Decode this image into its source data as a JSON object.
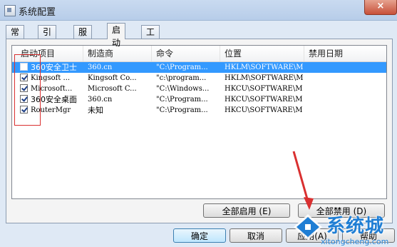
{
  "window": {
    "title": "系统配置",
    "close_glyph": "×"
  },
  "tabs": [
    {
      "label": "常规"
    },
    {
      "label": "引导"
    },
    {
      "label": "服务"
    },
    {
      "label": "启动",
      "active": true
    },
    {
      "label": "工具"
    }
  ],
  "list": {
    "columns": [
      "启动项目",
      "制造商",
      "命令",
      "位置",
      "禁用日期"
    ],
    "rows": [
      {
        "checked": false,
        "selected": true,
        "item": "360安全卫士",
        "maker": "360.cn",
        "command": "\"C:\\Program...",
        "location": "HKLM\\SOFTWARE\\M...",
        "disabled_date": ""
      },
      {
        "checked": true,
        "selected": false,
        "item": "Kingsoft ...",
        "maker": "Kingsoft Co...",
        "command": "\"c:\\program...",
        "location": "HKLM\\SOFTWARE\\M...",
        "disabled_date": ""
      },
      {
        "checked": true,
        "selected": false,
        "item": "Microsoft...",
        "maker": "Microsoft C...",
        "command": "\"C:\\Windows...",
        "location": "HKCU\\SOFTWARE\\M...",
        "disabled_date": ""
      },
      {
        "checked": true,
        "selected": false,
        "item": "360安全桌面",
        "maker": "360.cn",
        "command": "\"C:\\Program...",
        "location": "HKCU\\SOFTWARE\\M...",
        "disabled_date": ""
      },
      {
        "checked": true,
        "selected": false,
        "item": "RouterMgr",
        "maker": "未知",
        "command": "\"C:\\Program...",
        "location": "HKCU\\SOFTWARE\\M...",
        "disabled_date": ""
      }
    ]
  },
  "buttons": {
    "enable_all": "全部启用 (E)",
    "disable_all": "全部禁用 (D)",
    "ok": "确定",
    "cancel": "取消",
    "apply": "应用(A)",
    "help": "帮助"
  },
  "watermark": {
    "text": "系统城",
    "url": "xitongcheng.com"
  },
  "colors": {
    "selection": "#3399ff",
    "annotation": "#d93030",
    "watermark": "#1f7ed4"
  }
}
